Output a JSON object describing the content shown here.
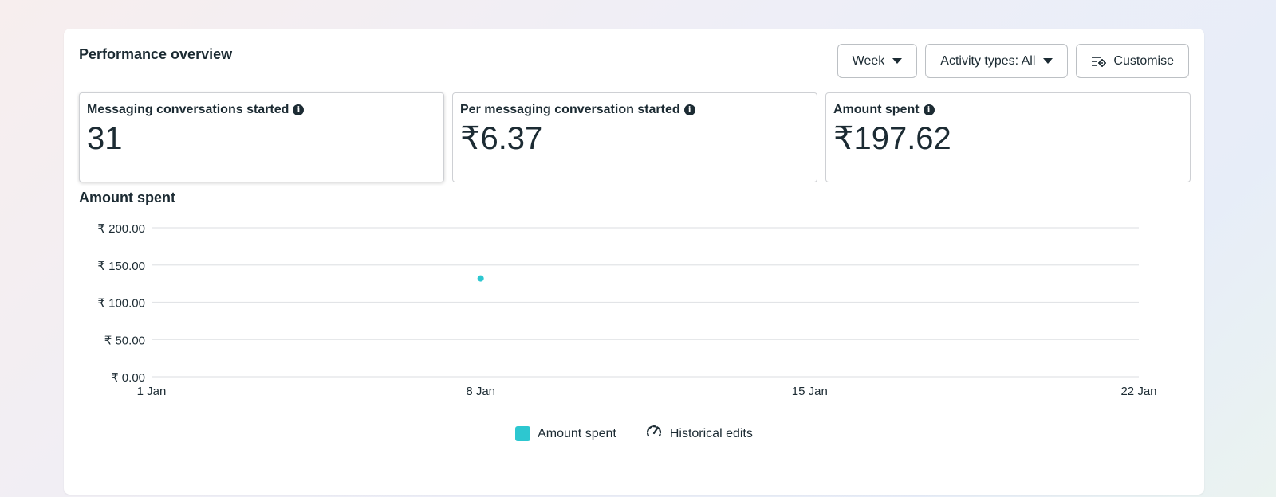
{
  "panel": {
    "title": "Performance overview"
  },
  "controls": {
    "period_label": "Week",
    "activity_label": "Activity types: All",
    "customise_label": "Customise"
  },
  "cards": [
    {
      "label": "Messaging conversations started",
      "value": "31",
      "delta": "—"
    },
    {
      "label": "Per messaging conversation started",
      "value": "₹6.37",
      "delta": "—"
    },
    {
      "label": "Amount spent",
      "value": "₹197.62",
      "delta": "—"
    }
  ],
  "colors": {
    "series": "#2dc7d0",
    "grid": "#e2e4e7",
    "text": "#1c2b33"
  },
  "chart_data": {
    "type": "scatter",
    "title": "Amount spent",
    "y_ticks": [
      "₹ 200.00",
      "₹ 150.00",
      "₹ 100.00",
      "₹ 50.00",
      "₹ 0.00"
    ],
    "y_tick_values": [
      200,
      150,
      100,
      50,
      0
    ],
    "x_ticks": [
      "1 Jan",
      "8 Jan",
      "15 Jan",
      "22 Jan"
    ],
    "x_tick_days": [
      1,
      8,
      15,
      22
    ],
    "ylim": [
      0,
      200
    ],
    "xlim": [
      1,
      22
    ],
    "grid": true,
    "legend_position": "bottom-center",
    "series": [
      {
        "name": "Amount spent",
        "points": [
          {
            "x": "8 Jan",
            "x_day": 8,
            "y": 132
          }
        ]
      }
    ],
    "legend": [
      "Amount spent",
      "Historical edits"
    ]
  }
}
